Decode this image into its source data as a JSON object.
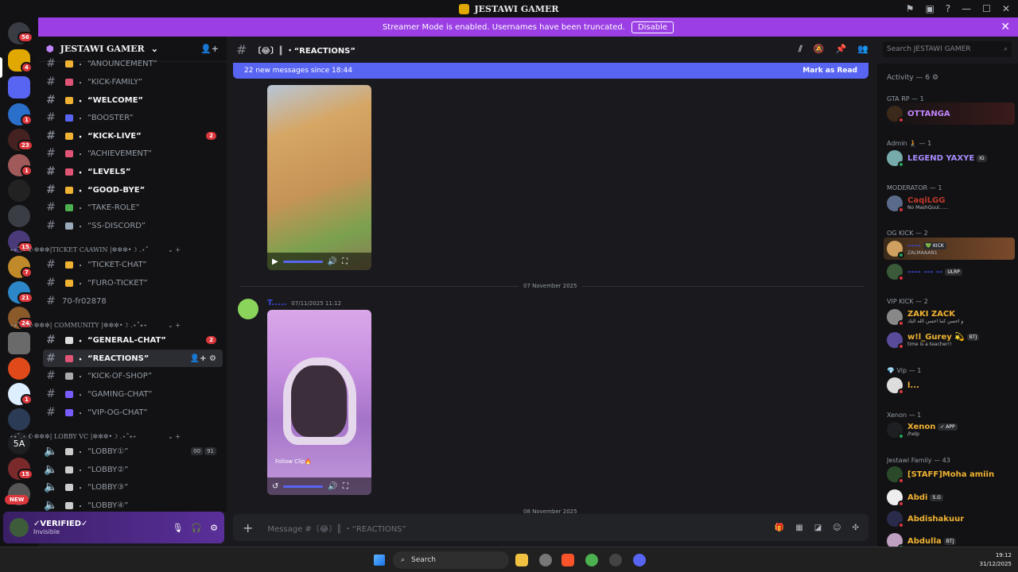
{
  "window": {
    "title": "JESTAWI GAMER"
  },
  "streamer": {
    "text": "Streamer Mode is enabled. Usernames have been truncated.",
    "button": "Disable"
  },
  "server_badges": {
    "home": "56",
    "s1": "4",
    "s3": "1",
    "s4": "23",
    "s5": "1",
    "s8": "15",
    "s9": "7",
    "s10": "21",
    "s11": "24",
    "s13": "1",
    "s16": "15",
    "new": "NEW",
    "label5a": "5A"
  },
  "sidebar": {
    "server_name": "JESTAWI GAMER",
    "channels": [
      {
        "label": "“ANOUNCEMENT”"
      },
      {
        "label": "“KICK-FAMILY”"
      },
      {
        "label": "“WELCOME”"
      },
      {
        "label": "“BOOSTER”"
      },
      {
        "label": "“KICK-LIVE”",
        "badge": "2"
      },
      {
        "label": "“ACHIEVEMENT”"
      },
      {
        "label": "“LEVELS”"
      },
      {
        "label": "“GOOD-BYE”"
      },
      {
        "label": "“TAKE-ROLE”"
      },
      {
        "label": "“SS-DISCORD”"
      },
      {
        "label": "“TICKET-CHAT”"
      },
      {
        "label": "“FURO-TICKET”"
      },
      {
        "label": "70-fr02878"
      },
      {
        "label": "“GENERAL-CHAT”",
        "badge": "2"
      },
      {
        "label": "“REACTIONS”"
      },
      {
        "label": "“KICK-OF-SHOP”"
      },
      {
        "label": "“GAMING-CHAT”"
      },
      {
        "label": "“VIP-OG-CHAT”"
      },
      {
        "label": "“LOBBY①”",
        "count1": "00",
        "count2": "91"
      },
      {
        "label": "“LOBBY②”"
      },
      {
        "label": "“LOBBY③”"
      },
      {
        "label": "“LOBBY④”"
      }
    ],
    "categories": [
      "⋆⭒˚.⋆ ☪︎✼✼✼|TICKET CAAWIN |✼✼✼•☽ .⋆˚",
      "⋆⭒˚.⋆ ☪︎✼✼✼| COMMUNITY |✼✼✼•☽ .⋆˚⭒⋆",
      "⋆⭒˚.⋆ ☪︎✼✼✼| LOBBY VC |✼✼✼•☽ .⋆˚⭒⋆"
    ],
    "prefix": "・"
  },
  "user": {
    "name": "✓VERIFIED✓",
    "status": "Invisible"
  },
  "channel_header": {
    "name": "〔😂〕║ ・“REACTIONS”"
  },
  "new_messages": {
    "text": "22 new messages since 18:44",
    "action": "Mark as Read"
  },
  "messages": {
    "divider1": "07 November 2025",
    "divider2": "08 November 2025",
    "author": "T.....",
    "timestamp": "07/11/2025 11:12",
    "overlay": "Follow Clip🔥"
  },
  "composer": {
    "placeholder": "Message #〔😂〕║ ・“REACTIONS”"
  },
  "search": {
    "placeholder": "Search JESTAWI GAMER"
  },
  "members": {
    "activity": "Activity — 6",
    "groups": [
      {
        "title": "GTA RP — 1"
      },
      {
        "title": "Admin 🧎 — 1"
      },
      {
        "title": "MODERATOR — 1"
      },
      {
        "title": "OG KICK — 2"
      },
      {
        "title": "VIP KICK — 2"
      },
      {
        "title": "💎 Vip — 1"
      },
      {
        "title": "Xenon — 1"
      },
      {
        "title": "Jestawi Family — 43"
      }
    ],
    "list": [
      {
        "name": "OTTANGA",
        "color": "#c084fc"
      },
      {
        "name": "LEGEND YAXYE",
        "color": "#a78bfa",
        "tag": "IG"
      },
      {
        "name": "CaqiLGG",
        "color": "#c0392b",
        "sub": "No MashQuul......"
      },
      {
        "name": "----",
        "color": "#3a47d8",
        "tag": "💚 KICK",
        "sub": "ZALMAAAN1"
      },
      {
        "name": "---- --- --",
        "color": "#3a47d8",
        "tag": "ULRP"
      },
      {
        "name": "ZAKI ZACK",
        "color": "#f0b232",
        "sub": "و احسن كما احسن الله اليك"
      },
      {
        "name": "w!l_Gurey 💫",
        "color": "#f0b232",
        "tag": "BTJ",
        "sub": "time is a teacher!!"
      },
      {
        "name": "l...",
        "color": "#f0b232"
      },
      {
        "name": "Xenon",
        "color": "#f0b232",
        "tag": "✓ APP",
        "sub": "/help"
      },
      {
        "name": "[STAFF]Moha amiin",
        "color": "#f0b232"
      },
      {
        "name": "Abdi",
        "color": "#f0b232",
        "tag": "S.G"
      },
      {
        "name": "Abdishakuur",
        "color": "#f0b232"
      },
      {
        "name": "Abdulla",
        "color": "#f0b232",
        "tag": "BTJ"
      }
    ]
  },
  "taskbar": {
    "search": "Search",
    "time": "19:12",
    "date": "31/12/2025"
  }
}
